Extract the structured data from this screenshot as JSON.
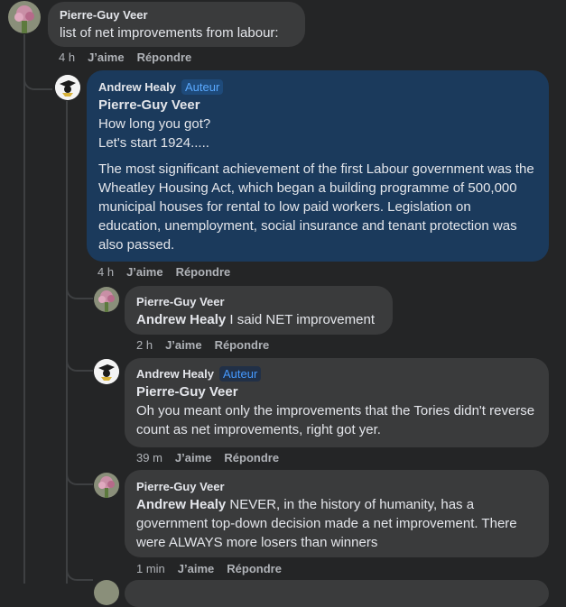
{
  "comments": [
    {
      "author": "Pierre-Guy Veer",
      "text": "list of net improvements from labour:",
      "time": "4 h",
      "like": "J’aime",
      "reply": "Répondre"
    },
    {
      "author": "Andrew Healy",
      "badge": "Auteur",
      "mention": "Pierre-Guy Veer",
      "line1": "How long you got?",
      "line2": "Let's start 1924.....",
      "paragraph": "The most significant achievement of the first Labour government was the Wheatley Housing Act, which began a building programme of 500,000 municipal houses for rental to low paid workers. Legislation on education, unemployment, social insurance and tenant protection was also passed.",
      "time": "4 h",
      "like": "J’aime",
      "reply": "Répondre"
    },
    {
      "author": "Pierre-Guy Veer",
      "mention": "Andrew Healy",
      "text": "I said NET improvement",
      "time": "2 h",
      "like": "J’aime",
      "reply": "Répondre"
    },
    {
      "author": "Andrew Healy",
      "badge": "Auteur",
      "mention": "Pierre-Guy Veer",
      "text": "Oh you meant only the improvements that the Tories didn't reverse count as net improvements, right got yer.",
      "time": "39 m",
      "like": "J’aime",
      "reply": "Répondre"
    },
    {
      "author": "Pierre-Guy Veer",
      "mention": "Andrew Healy",
      "text": "NEVER, in the history of humanity, has a government top-down decision made a net improvement. There were ALWAYS more losers than winners",
      "time": "1 min",
      "like": "J’aime",
      "reply": "Répondre"
    }
  ]
}
